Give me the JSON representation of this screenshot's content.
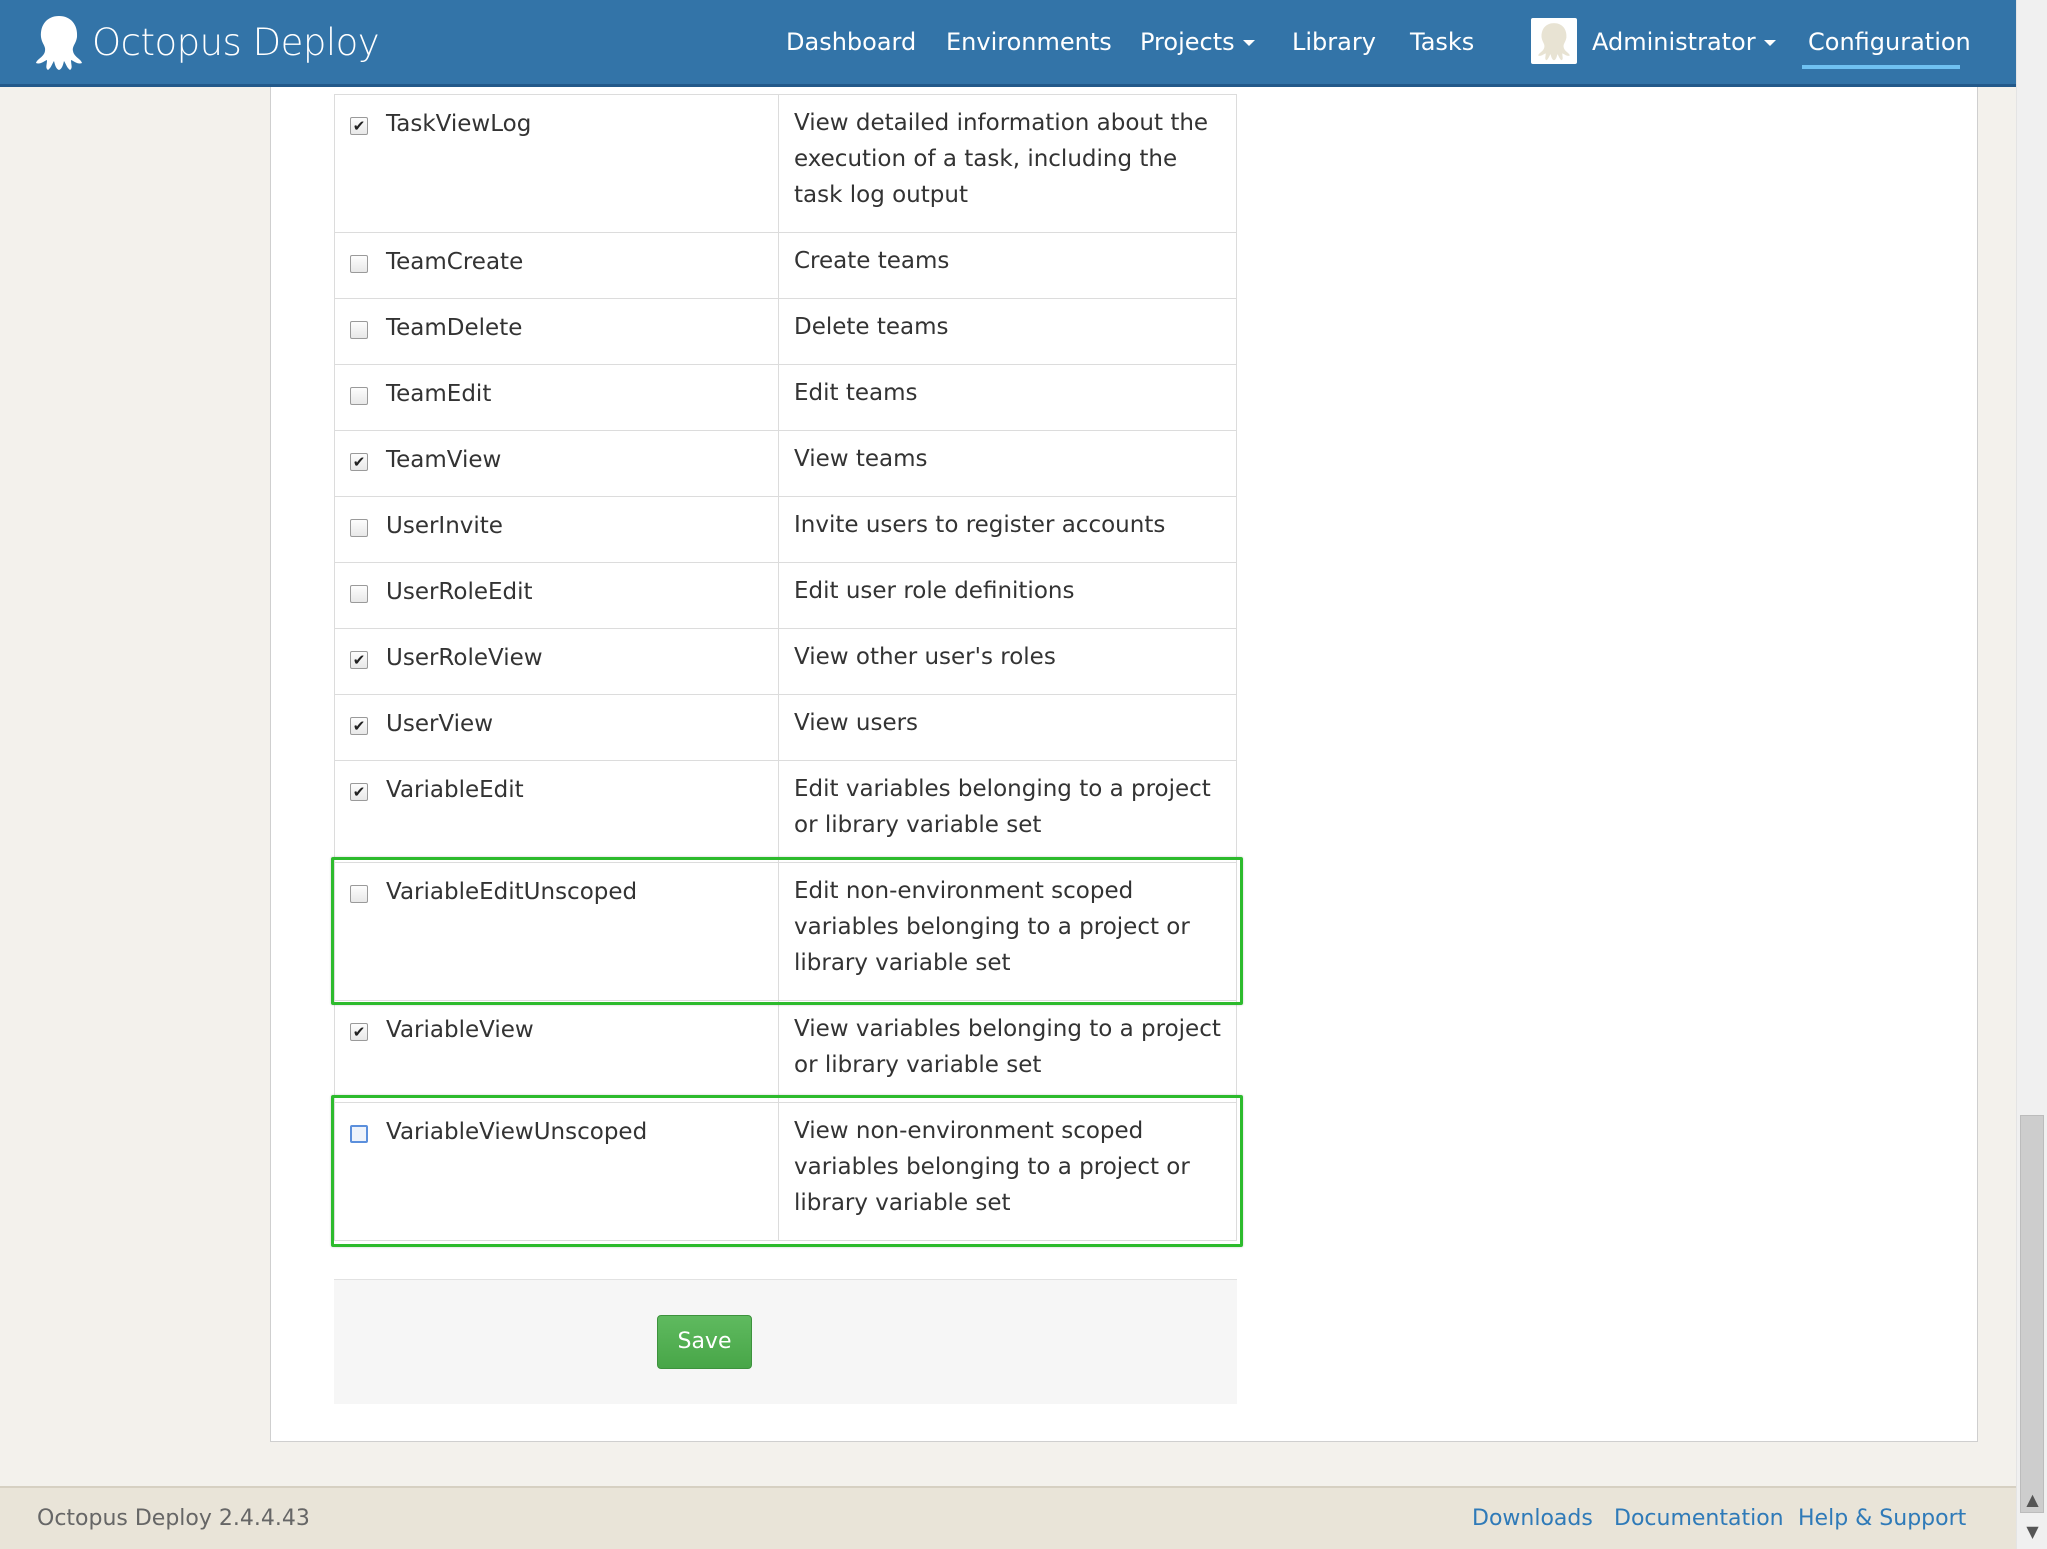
{
  "app": {
    "brand_name": "Octopus Deploy",
    "version_text": "Octopus Deploy 2.4.4.43"
  },
  "nav": {
    "items": [
      {
        "label": "Dashboard"
      },
      {
        "label": "Environments"
      },
      {
        "label": "Projects",
        "dropdown": true
      },
      {
        "label": "Library"
      },
      {
        "label": "Tasks"
      }
    ],
    "user_label": "Administrator",
    "active_label": "Configuration"
  },
  "permissions": [
    {
      "name": "TaskViewLog",
      "description": "View detailed information about the execution of a task, including the task log output",
      "checked": true
    },
    {
      "name": "TeamCreate",
      "description": "Create teams",
      "checked": false
    },
    {
      "name": "TeamDelete",
      "description": "Delete teams",
      "checked": false
    },
    {
      "name": "TeamEdit",
      "description": "Edit teams",
      "checked": false
    },
    {
      "name": "TeamView",
      "description": "View teams",
      "checked": true
    },
    {
      "name": "UserInvite",
      "description": "Invite users to register accounts",
      "checked": false
    },
    {
      "name": "UserRoleEdit",
      "description": "Edit user role definitions",
      "checked": false
    },
    {
      "name": "UserRoleView",
      "description": "View other user's roles",
      "checked": true
    },
    {
      "name": "UserView",
      "description": "View users",
      "checked": true
    },
    {
      "name": "VariableEdit",
      "description": "Edit variables belonging to a project or library variable set",
      "checked": true
    },
    {
      "name": "VariableEditUnscoped",
      "description": "Edit non-environment scoped variables belonging to a project or library variable set",
      "checked": false,
      "highlighted": true
    },
    {
      "name": "VariableView",
      "description": "View variables belonging to a project or library variable set",
      "checked": true
    },
    {
      "name": "VariableViewUnscoped",
      "description": "View non-environment scoped variables belonging to a project or library variable set",
      "checked": false,
      "highlighted": true,
      "focused": true
    }
  ],
  "actions": {
    "save_label": "Save"
  },
  "footer": {
    "links": [
      {
        "label": "Downloads"
      },
      {
        "label": "Documentation"
      },
      {
        "label": "Help & Support"
      }
    ]
  },
  "colors": {
    "navbar": "#3374a8",
    "highlight": "#2dbb2d",
    "save_button": "#4cae4c",
    "link": "#2f7ab8"
  }
}
